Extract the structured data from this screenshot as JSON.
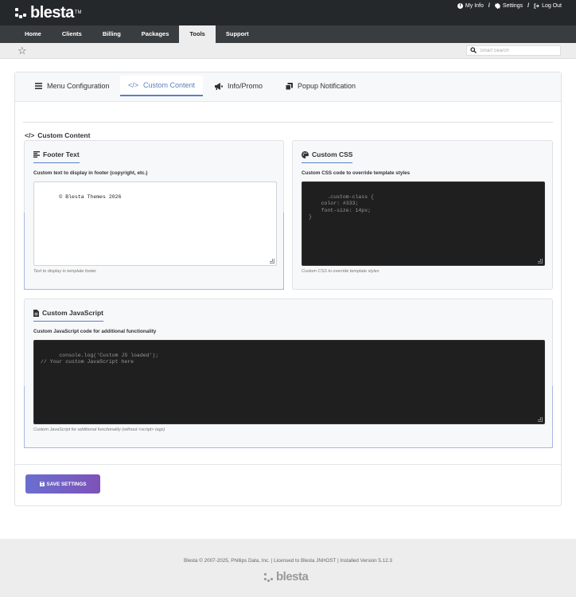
{
  "brand": {
    "name": "blesta",
    "tm": "TM"
  },
  "top_links": [
    {
      "icon": "info-icon",
      "label": "My Info"
    },
    {
      "icon": "gear-icon",
      "label": "Settings"
    },
    {
      "icon": "logout-icon",
      "label": "Log Out"
    }
  ],
  "top_separator": "/",
  "nav": {
    "items": [
      "Home",
      "Clients",
      "Billing",
      "Packages",
      "Tools",
      "Support"
    ],
    "active": "Tools"
  },
  "search": {
    "placeholder": "Smart Search"
  },
  "tabs": [
    {
      "label": "Menu Configuration",
      "icon": "menu-icon"
    },
    {
      "label": "Custom Content",
      "icon": "code-icon",
      "active": true
    },
    {
      "label": "Info/Promo",
      "icon": "megaphone-icon"
    },
    {
      "label": "Popup Notification",
      "icon": "popup-icon"
    }
  ],
  "section": {
    "title": "Custom Content"
  },
  "footer_text_card": {
    "title": "Footer Text",
    "description": "Custom text to display in footer (copyright, etc.)",
    "value": "© Blesta Themes 2026",
    "help": "Text to display in template footer"
  },
  "custom_css_card": {
    "title": "Custom CSS",
    "description": "Custom CSS code to override template styles",
    "value": ".custom-class {\n    color: #333;\n    font-size: 14px;\n}",
    "help": "Custom CSS to override template styles"
  },
  "custom_js_card": {
    "title": "Custom JavaScript",
    "description": "Custom JavaScript code for additional functionality",
    "value": "console.log('Custom JS loaded');\n// Your custom JavaScript here",
    "help": "Custom JavaScript for additional functionality (without <script> tags)"
  },
  "save_button": {
    "label": "SAVE SETTINGS"
  },
  "footer": {
    "copyright": "Blesta © 2007-2025, Phillips Data, Inc. | Licensed to Blesta JNHOST | Installed Version 5.12.3",
    "logo": "blesta"
  },
  "colors": {
    "accent": "#5a7fc2",
    "topbar": "#25282b",
    "navbar": "#3a3d40",
    "button_start": "#6a6fcf",
    "button_end": "#7e52b8"
  }
}
